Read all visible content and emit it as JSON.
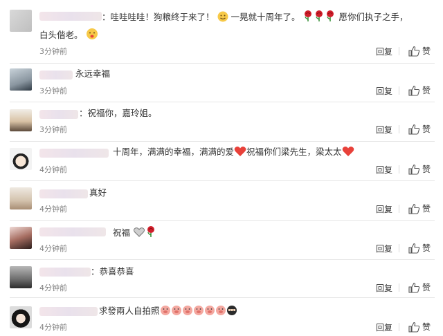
{
  "comments": [
    {
      "text_line1": "：哇哇哇哇！狗粮终于来了！",
      "text_mid": " 一晃就十周年了。",
      "text_end": "愿你们执子之手，",
      "text_line2": "白头偕老。",
      "time": "3分钟前",
      "reply": "回复",
      "like": "赞"
    },
    {
      "text": "永远幸福",
      "time": "3分钟前",
      "reply": "回复",
      "like": "赞"
    },
    {
      "text": "：祝福你，嘉玲姐。",
      "time": "3分钟前",
      "reply": "回复",
      "like": "赞"
    },
    {
      "text_a": "十周年，满满的幸福，满满的爱",
      "text_b": "祝福你们梁先生，梁太太",
      "time": "4分钟前",
      "reply": "回复",
      "like": "赞"
    },
    {
      "text": "真好",
      "time": "4分钟前",
      "reply": "回复",
      "like": "赞"
    },
    {
      "text": "祝福",
      "time": "4分钟前",
      "reply": "回复",
      "like": "赞"
    },
    {
      "text": "：恭喜恭喜",
      "time": "4分钟前",
      "reply": "回复",
      "like": "赞"
    },
    {
      "text": "求發兩人自拍照",
      "time": "4分钟前",
      "reply": "回复",
      "like": "赞"
    }
  ],
  "icons": {
    "emoji": "smile-emoji",
    "rose": "rose-emoji",
    "heart": "heart-emoji",
    "thumb": "thumbs-up-icon",
    "pig": "pig-emoji",
    "ninja": "ninja-emoji"
  },
  "colors": {
    "time": "#808080",
    "text": "#333333",
    "divider": "#e6e6e6",
    "heart": "#e8413a",
    "rose": "#d01e2a"
  }
}
